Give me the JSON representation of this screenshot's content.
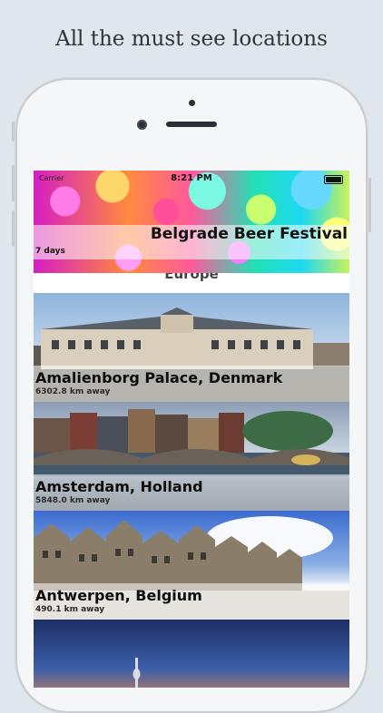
{
  "promo": {
    "caption": "All the must see locations"
  },
  "status_bar": {
    "carrier": "Carrier",
    "time": "8:21 PM"
  },
  "banner": {
    "title": "Belgrade Beer Festival",
    "subtitle": "7 days"
  },
  "section": {
    "title": "Europe"
  },
  "locations": [
    {
      "name": "Amalienborg Palace, Denmark",
      "distance": "6302.8 km away"
    },
    {
      "name": "Amsterdam, Holland",
      "distance": "5848.0 km away"
    },
    {
      "name": "Antwerpen, Belgium",
      "distance": "490.1 km away"
    }
  ],
  "colors": {
    "background": "#dfe7ec",
    "phone": "#f5f6f7",
    "label_strip": "#ffffff"
  }
}
